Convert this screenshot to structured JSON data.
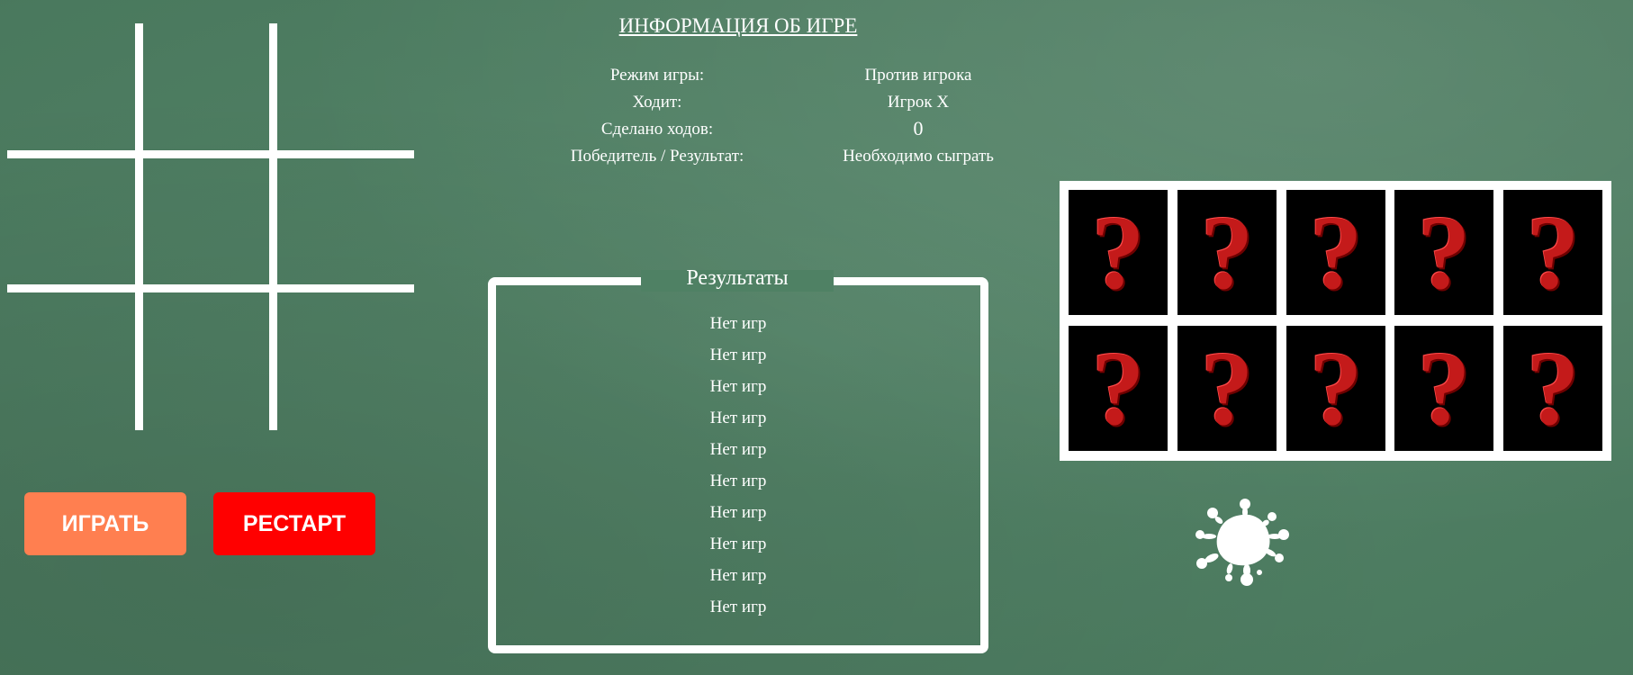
{
  "game_board": {
    "cells": [
      "",
      "",
      "",
      "",
      "",
      "",
      "",
      "",
      ""
    ],
    "line_color": "#ffffff"
  },
  "buttons": {
    "play_label": "ИГРАТЬ",
    "play_color": "#ff7f50",
    "restart_label": "РЕСТАРТ",
    "restart_color": "#ff0000"
  },
  "info": {
    "title": "ИНФОРМАЦИЯ ОБ ИГРЕ",
    "rows": [
      {
        "label": "Режим игры:",
        "value": "Против игрока"
      },
      {
        "label": "Ходит:",
        "value": "Игрок X"
      },
      {
        "label": "Сделано ходов:",
        "value": "0"
      },
      {
        "label": "Победитель / Результат:",
        "value": "Необходимо сыграть"
      }
    ]
  },
  "results": {
    "title": "Результаты",
    "items": [
      "Нет игр",
      "Нет игр",
      "Нет игр",
      "Нет игр",
      "Нет игр",
      "Нет игр",
      "Нет игр",
      "Нет игр",
      "Нет игр",
      "Нет игр"
    ]
  },
  "memory": {
    "card_face": "?",
    "cards": [
      "?",
      "?",
      "?",
      "?",
      "?",
      "?",
      "?",
      "?",
      "?",
      "?"
    ],
    "card_color": "#c41a1a"
  },
  "splat_icon": "splat-icon"
}
